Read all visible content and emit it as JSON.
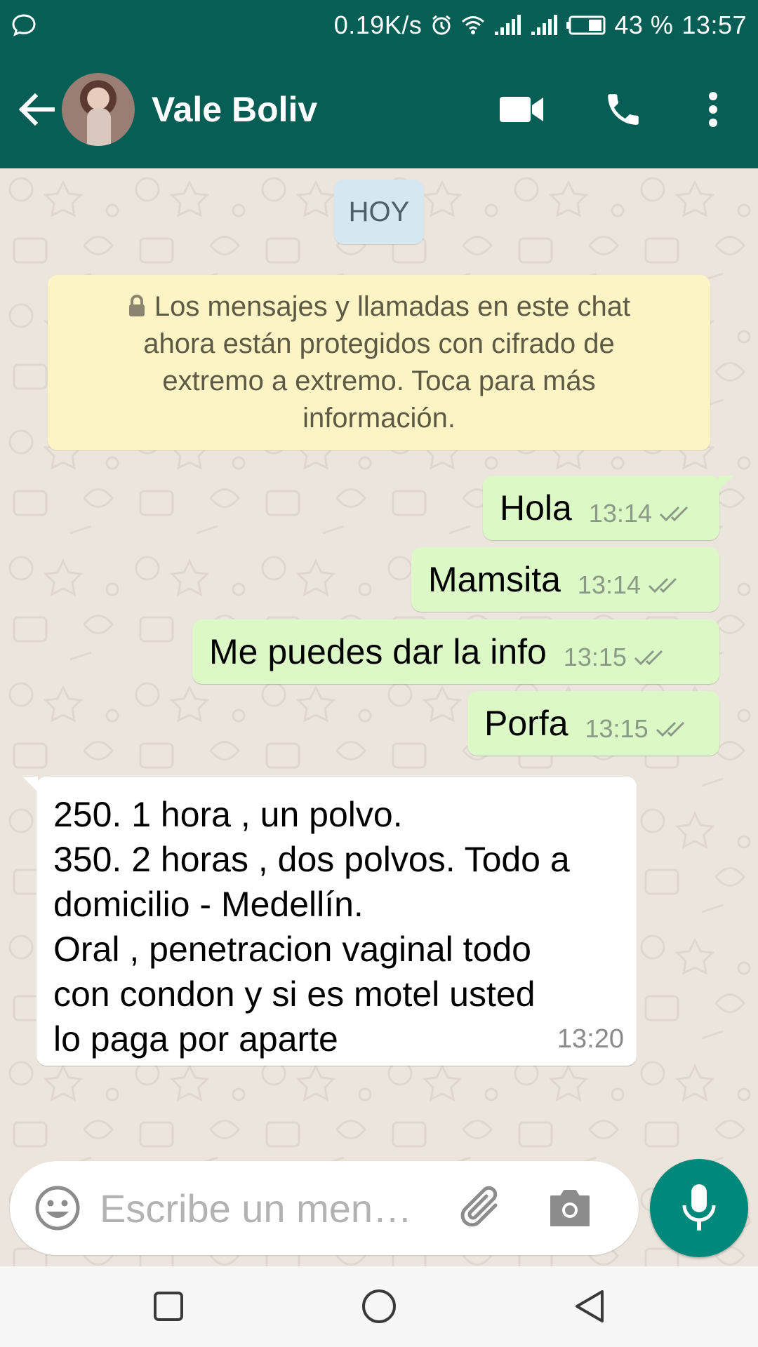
{
  "status_bar": {
    "net_speed": "0.19K/s",
    "battery": "43 %",
    "time": "13:57"
  },
  "header": {
    "contact_name": "Vale Boliv",
    "icons": [
      "back-arrow-icon",
      "video-call-icon",
      "phone-icon",
      "more-vert-icon"
    ]
  },
  "chat": {
    "date_chip": "HOY",
    "encryption_notice": "Los mensajes y llamadas en este chat ahora están protegidos con cifrado de extremo a extremo. Toca para más información.",
    "outgoing": [
      {
        "text": "Hola",
        "time": "13:14"
      },
      {
        "text": "Mamsita",
        "time": "13:14"
      },
      {
        "text": "Me puedes dar la info",
        "time": "13:15"
      },
      {
        "text": "Porfa",
        "time": "13:15"
      }
    ],
    "incoming": {
      "lines": [
        "250. 1 hora , un polvo.",
        "350. 2 horas , dos polvos. Todo a",
        "domicilio - Medellín.",
        "Oral , penetracion vaginal todo",
        "con condon y si es motel usted",
        "lo paga por aparte"
      ],
      "time": "13:20"
    }
  },
  "composer": {
    "placeholder": "Escribe un men…"
  },
  "colors": {
    "header": "#075e54",
    "outgoing_bubble": "#dcf8c6",
    "incoming_bubble": "#ffffff",
    "notice": "#fcf4c4",
    "date_chip": "#d5e8f2",
    "mic_button": "#00897b",
    "chat_bg": "#ece5dd"
  }
}
